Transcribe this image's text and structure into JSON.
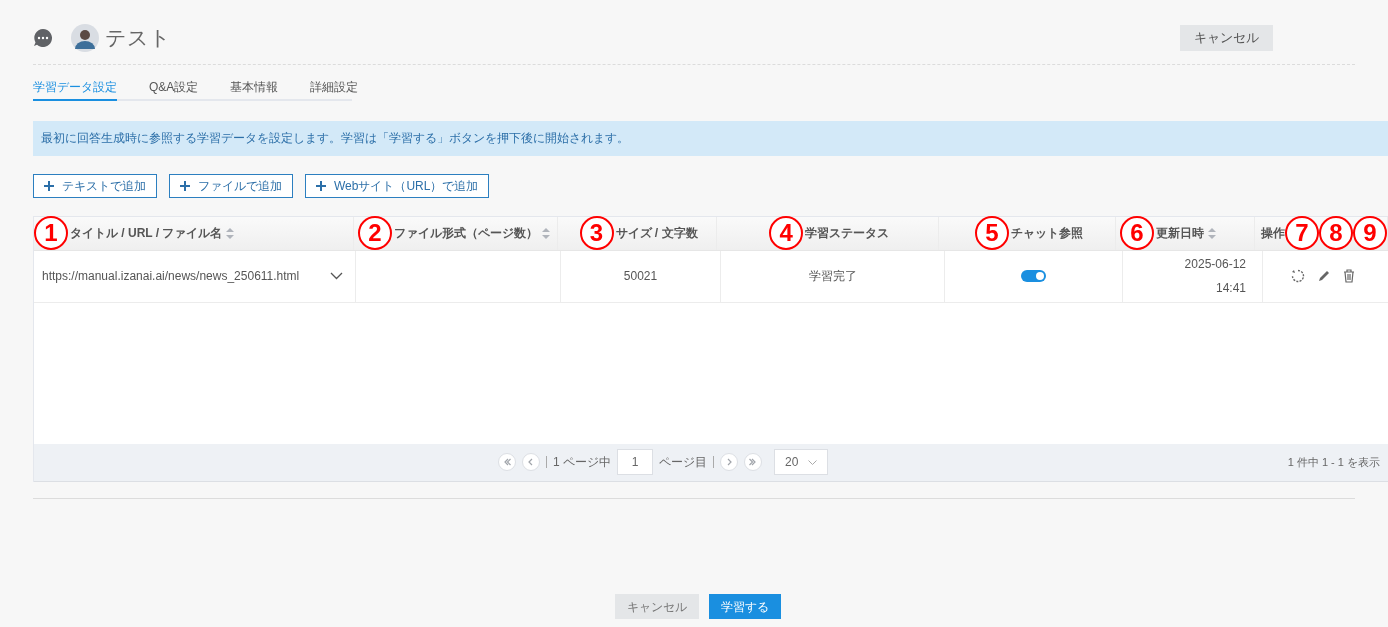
{
  "header": {
    "title": "テスト",
    "cancel": "キャンセル"
  },
  "tabs": [
    {
      "label": "学習データ設定",
      "selected": true
    },
    {
      "label": "Q&A設定",
      "selected": false
    },
    {
      "label": "基本情報",
      "selected": false
    },
    {
      "label": "詳細設定",
      "selected": false
    }
  ],
  "notice": "最初に回答生成時に参照する学習データを設定します。学習は「学習する」ボタンを押下後に開始されます。",
  "add_buttons": [
    "テキストで追加",
    "ファイルで追加",
    "Webサイト（URL）で追加"
  ],
  "table": {
    "columns": [
      {
        "label": "タイトル / URL / ファイル名",
        "sortable": true,
        "callouts": [
          "1"
        ]
      },
      {
        "label": "ファイル形式（ページ数）",
        "sortable": true,
        "callouts": [
          "2"
        ]
      },
      {
        "label": "サイズ / 文字数",
        "sortable": false,
        "callouts": [
          "3"
        ]
      },
      {
        "label": "学習ステータス",
        "sortable": false,
        "callouts": [
          "4"
        ]
      },
      {
        "label": "チャット参照",
        "sortable": false,
        "callouts": [
          "5"
        ]
      },
      {
        "label": "更新日時",
        "sortable": true,
        "callouts": [
          "6"
        ]
      },
      {
        "label": "操作",
        "sortable": false,
        "callouts": [
          "7",
          "8",
          "9"
        ]
      }
    ],
    "rows": [
      {
        "title": "https://manual.izanai.ai/news/news_250611.html",
        "size": "50021",
        "status": "学習完了",
        "chat_reference": true,
        "updated_date": "2025-06-12",
        "updated_time": "14:41"
      }
    ]
  },
  "pagination": {
    "page_count": "1 ページ中",
    "page": "1",
    "page_suffix": "ページ目",
    "per_page": "20",
    "summary": "1 件中 1 - 1 を表示"
  },
  "footer": {
    "cancel": "キャンセル",
    "submit": "学習する"
  }
}
